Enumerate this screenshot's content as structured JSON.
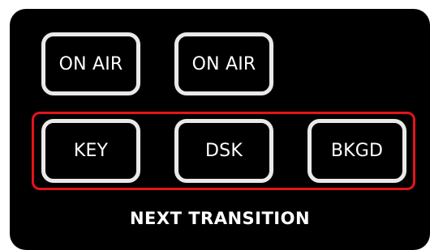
{
  "on_air_buttons": [
    {
      "label": "ON AIR"
    },
    {
      "label": "ON AIR"
    }
  ],
  "next_transition": {
    "buttons": [
      {
        "label": "KEY"
      },
      {
        "label": "DSK"
      },
      {
        "label": "BKGD"
      }
    ],
    "title": "NEXT TRANSITION"
  },
  "colors": {
    "panel_background": "#000000",
    "button_border": "#e9e9e9",
    "button_text": "#ffffff",
    "highlight_border": "#e3141c"
  }
}
